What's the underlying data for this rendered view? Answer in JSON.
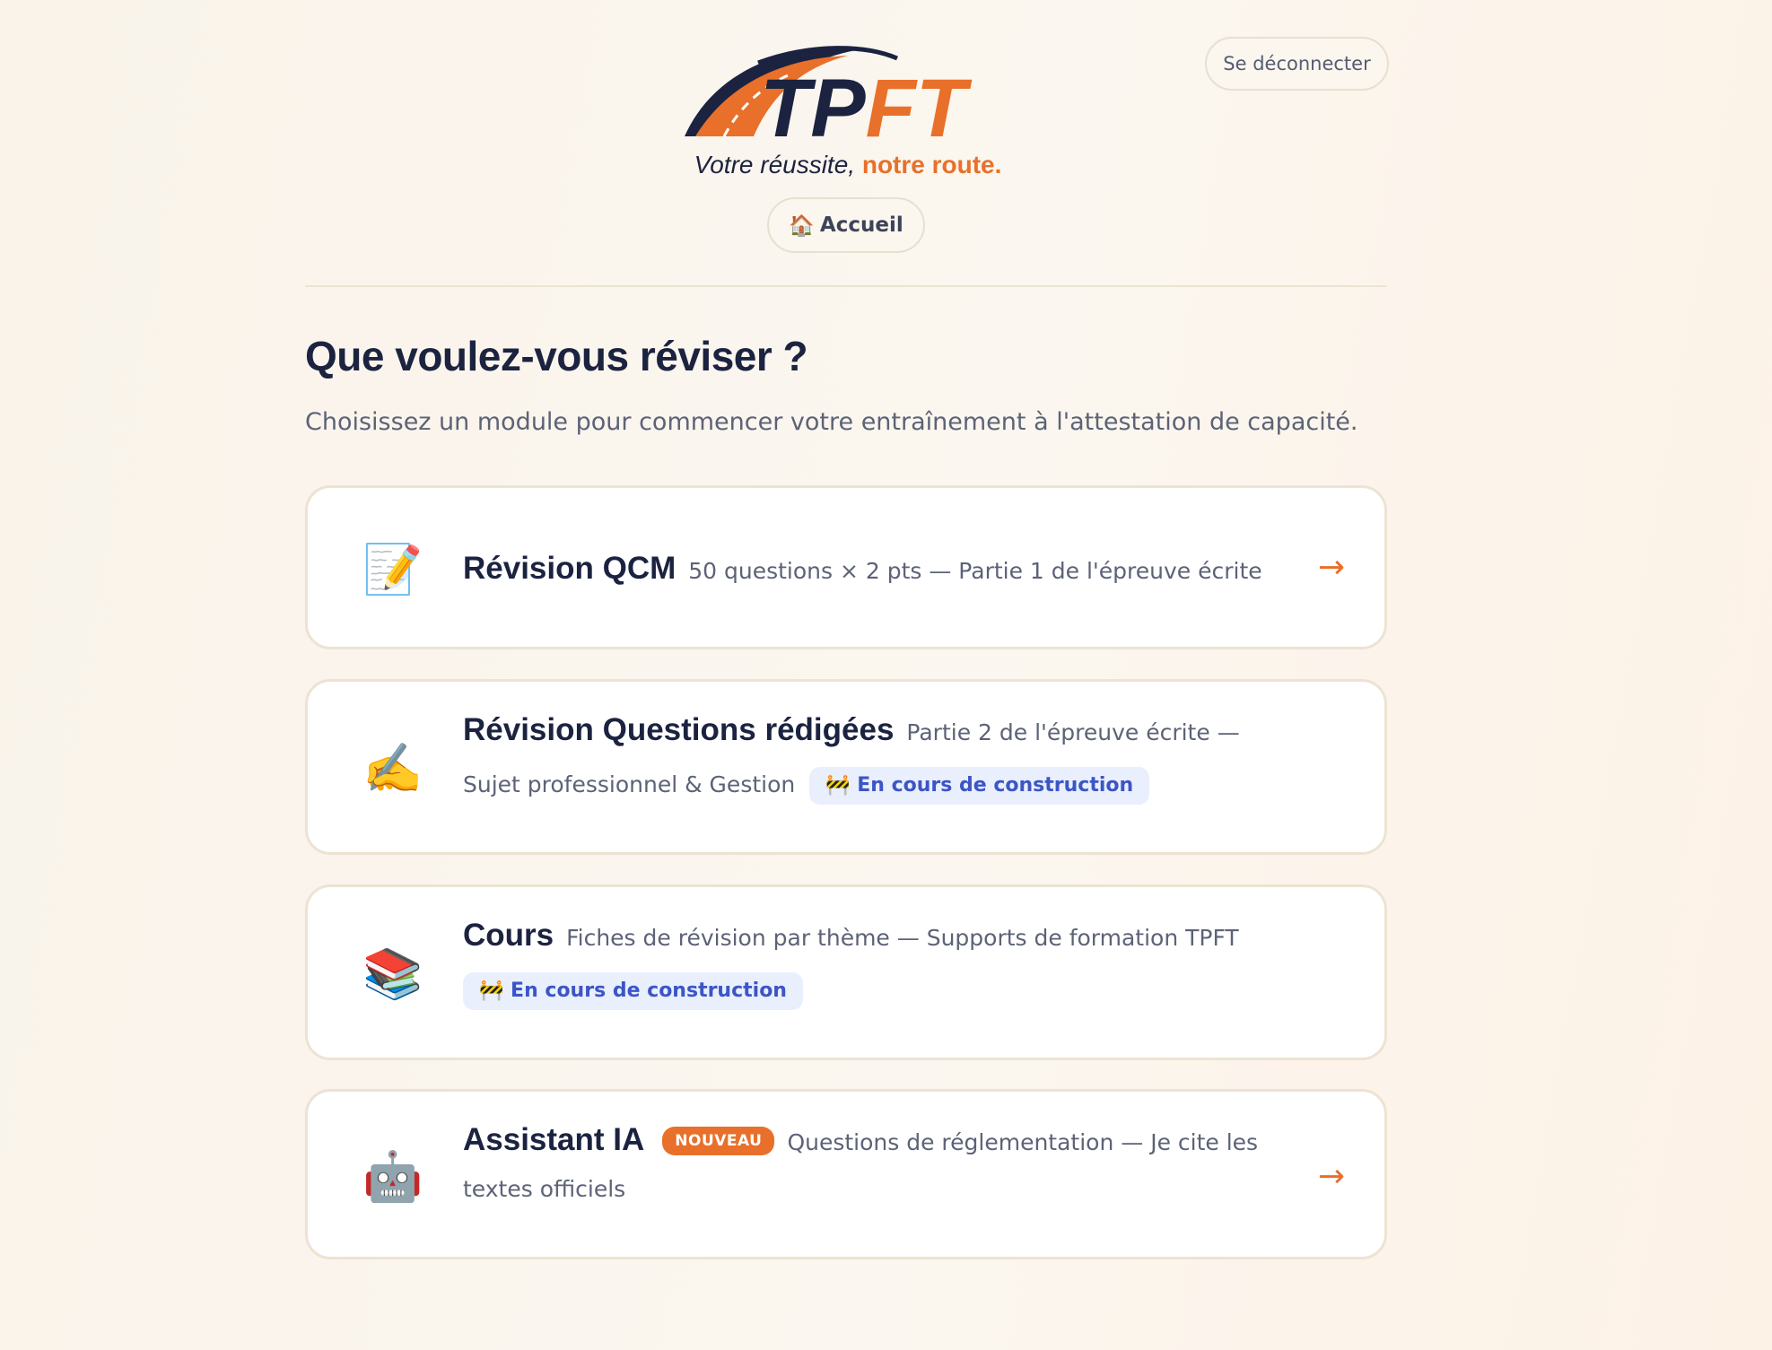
{
  "header": {
    "logout_label": "Se déconnecter",
    "logo_text": "TPFT",
    "tagline_main": "Votre réussite,",
    "tagline_accent": "notre route.",
    "home_icon": "🏠",
    "home_label": "Accueil"
  },
  "intro": {
    "title": "Que voulez-vous réviser ?",
    "subtitle": "Choisissez un module pour commencer votre entraînement à l'attestation de capacité."
  },
  "modules": [
    {
      "icon": "📝",
      "title": "Révision QCM",
      "description": "50 questions × 2 pts — Partie 1 de l'épreuve écrite",
      "arrow": "→"
    },
    {
      "icon": "✍️",
      "title": "Révision Questions rédigées",
      "description": "Partie 2 de l'épreuve écrite — Sujet professionnel & Gestion",
      "badge": "🚧 En cours de construction"
    },
    {
      "icon": "📚",
      "title": "Cours",
      "description": "Fiches de révision par thème — Supports de formation TPFT",
      "badge": "🚧 En cours de construction"
    },
    {
      "icon": "🤖",
      "title": "Assistant IA",
      "new_badge": "NOUVEAU",
      "description": "Questions de réglementation — Je cite les textes officiels",
      "arrow": "→"
    }
  ],
  "colors": {
    "accent": "#e8702a",
    "navy": "#1b2340",
    "badge_blue_bg": "#e9effc",
    "badge_blue_text": "#3c55c6"
  }
}
